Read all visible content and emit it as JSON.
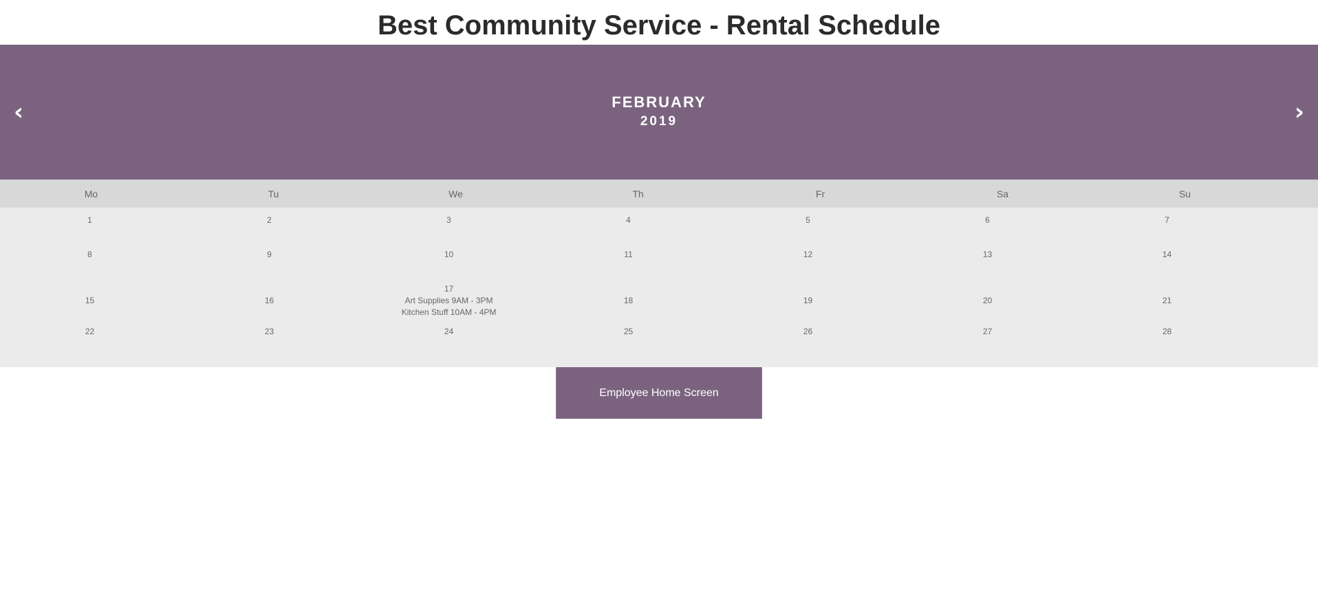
{
  "page": {
    "title": "Best Community Service - Rental Schedule"
  },
  "header": {
    "prev_icon": "‹",
    "next_icon": "›",
    "month": "FEBRUARY",
    "year": "2019"
  },
  "weekdays": [
    "Mo",
    "Tu",
    "We",
    "Th",
    "Fr",
    "Sa",
    "Su"
  ],
  "weeks": [
    [
      "1",
      "2",
      "3",
      "4",
      "5",
      "6",
      "7"
    ],
    [
      "8",
      "9",
      "10",
      "11",
      "12",
      "13",
      "14"
    ],
    [
      "15",
      "16",
      "17",
      "18",
      "19",
      "20",
      "21"
    ],
    [
      "22",
      "23",
      "24",
      "25",
      "26",
      "27",
      "28"
    ]
  ],
  "events": {
    "day17": [
      "Art Supplies 9AM - 3PM",
      "Kitchen Stuff 10AM - 4PM"
    ]
  },
  "footer": {
    "home_button_label": "Employee Home Screen"
  },
  "colors": {
    "accent": "#7b6380",
    "weekday_bg": "#d8d8d8",
    "grid_bg": "#ebebeb",
    "text": "#666666"
  }
}
